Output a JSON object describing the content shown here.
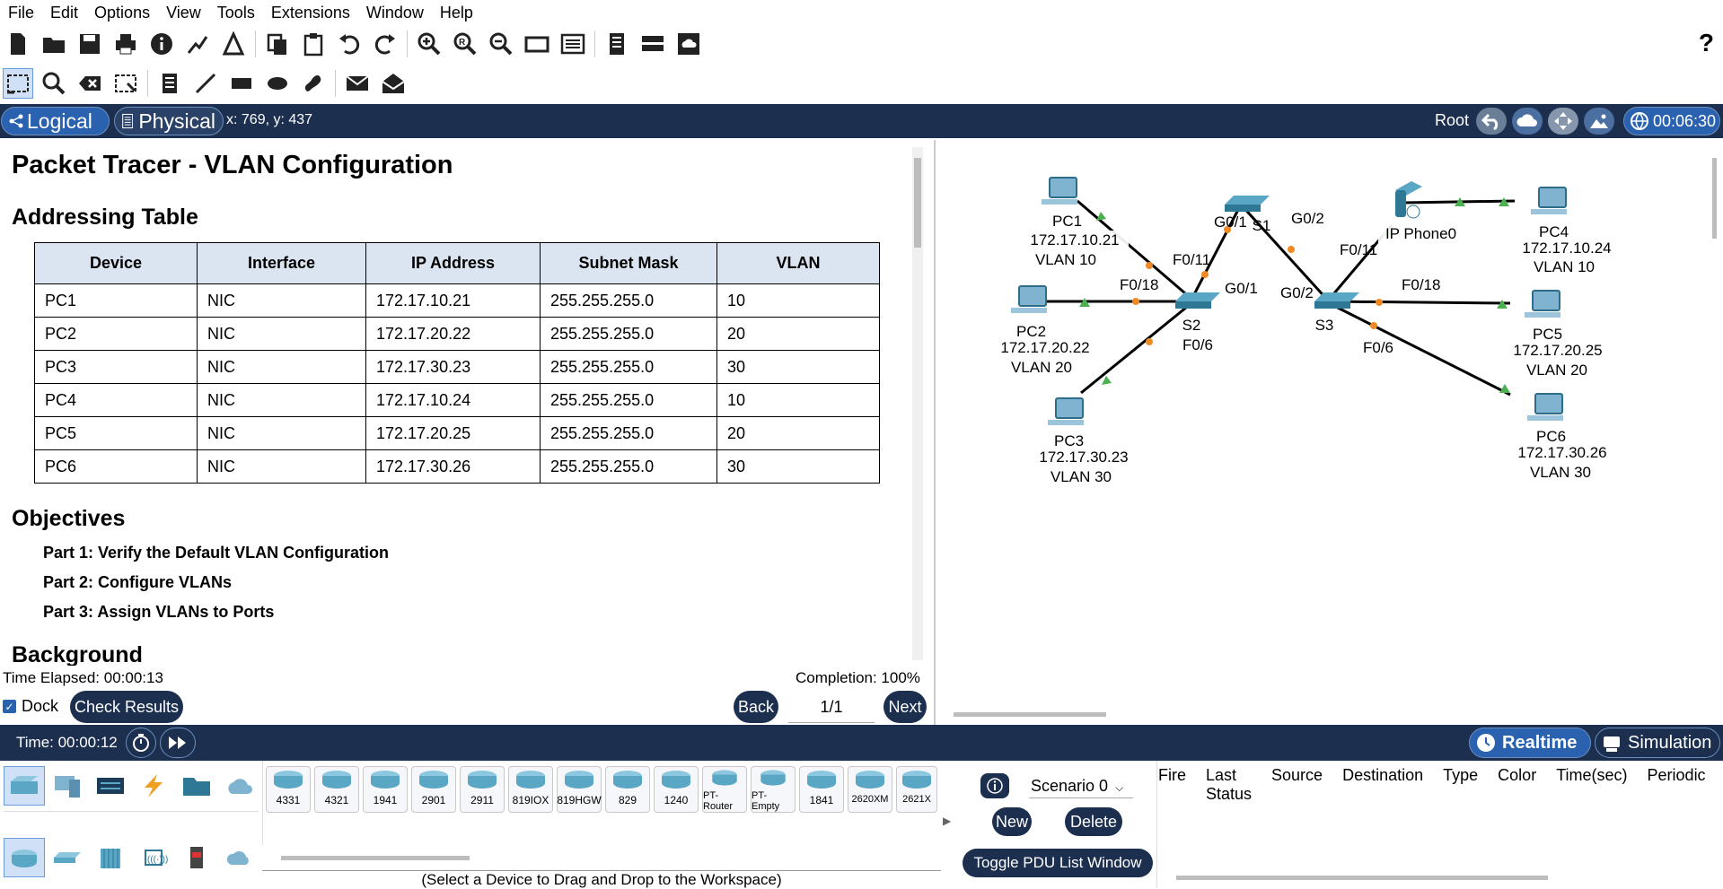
{
  "menu": [
    "File",
    "Edit",
    "Options",
    "View",
    "Tools",
    "Extensions",
    "Window",
    "Help"
  ],
  "help_label": "?",
  "nav": {
    "logical_label": "Logical",
    "physical_label": "Physical",
    "coords": "x: 769, y: 437",
    "root_label": "Root",
    "clock": "00:06:30"
  },
  "instructions": {
    "title": "Packet Tracer - VLAN Configuration",
    "addressing_heading": "Addressing Table",
    "table_headers": [
      "Device",
      "Interface",
      "IP Address",
      "Subnet Mask",
      "VLAN"
    ],
    "table_rows": [
      [
        "PC1",
        "NIC",
        "172.17.10.21",
        "255.255.255.0",
        "10"
      ],
      [
        "PC2",
        "NIC",
        "172.17.20.22",
        "255.255.255.0",
        "20"
      ],
      [
        "PC3",
        "NIC",
        "172.17.30.23",
        "255.255.255.0",
        "30"
      ],
      [
        "PC4",
        "NIC",
        "172.17.10.24",
        "255.255.255.0",
        "10"
      ],
      [
        "PC5",
        "NIC",
        "172.17.20.25",
        "255.255.255.0",
        "20"
      ],
      [
        "PC6",
        "NIC",
        "172.17.30.26",
        "255.255.255.0",
        "30"
      ]
    ],
    "objectives_heading": "Objectives",
    "objectives": [
      "Part 1: Verify the Default VLAN Configuration",
      "Part 2: Configure VLANs",
      "Part 3: Assign VLANs to Ports"
    ],
    "background_heading": "Background",
    "time_elapsed": "Time Elapsed: 00:00:13",
    "completion": "Completion: 100%",
    "dock_label": "Dock",
    "check_results": "Check Results",
    "back_label": "Back",
    "page_indicator": "1/1",
    "next_label": "Next"
  },
  "topology": {
    "devices": {
      "pc1": {
        "name": "PC1",
        "ip": "172.17.10.21",
        "vlan": "VLAN 10"
      },
      "pc2": {
        "name": "PC2",
        "ip": "172.17.20.22",
        "vlan": "VLAN 20"
      },
      "pc3": {
        "name": "PC3",
        "ip": "172.17.30.23",
        "vlan": "VLAN 30"
      },
      "pc4": {
        "name": "PC4",
        "ip": "172.17.10.24",
        "vlan": "VLAN 10"
      },
      "pc5": {
        "name": "PC5",
        "ip": "172.17.20.25",
        "vlan": "VLAN 20"
      },
      "pc6": {
        "name": "PC6",
        "ip": "172.17.30.26",
        "vlan": "VLAN 30"
      },
      "s1": {
        "name": "S1"
      },
      "s2": {
        "name": "S2"
      },
      "s3": {
        "name": "S3"
      },
      "phone": {
        "name": "IP Phone0"
      }
    },
    "ports": {
      "s1_g01": "G0/1",
      "s1_g02": "G0/2",
      "s2_f011": "F0/11",
      "s2_f018": "F0/18",
      "s2_g01": "G0/1",
      "s2_f06": "F0/6",
      "s3_g02": "G0/2",
      "s3_f011": "F0/11",
      "s3_f018": "F0/18",
      "s3_f06": "F0/6"
    }
  },
  "bottom": {
    "time": "Time: 00:00:12",
    "realtime_label": "Realtime",
    "simulation_label": "Simulation",
    "device_models": [
      "4331",
      "4321",
      "1941",
      "2901",
      "2911",
      "819IOX",
      "819HGW",
      "829",
      "1240",
      "PT-Router",
      "PT-Empty",
      "1841",
      "2620XM",
      "2621X"
    ],
    "hint": "(Select a Device to Drag and Drop to the Workspace)",
    "scenario": "Scenario 0",
    "new_label": "New",
    "delete_label": "Delete",
    "toggle_pdu": "Toggle PDU List Window",
    "pdu_columns": [
      "Fire",
      "Last Status",
      "Source",
      "Destination",
      "Type",
      "Color",
      "Time(sec)",
      "Periodic"
    ]
  },
  "colors": {
    "nav_bg": "#1c2f4f",
    "accent": "#2a62b0",
    "link_green": "#4caf50",
    "link_orange": "#f08a24",
    "table_header": "#dbe5f1"
  }
}
